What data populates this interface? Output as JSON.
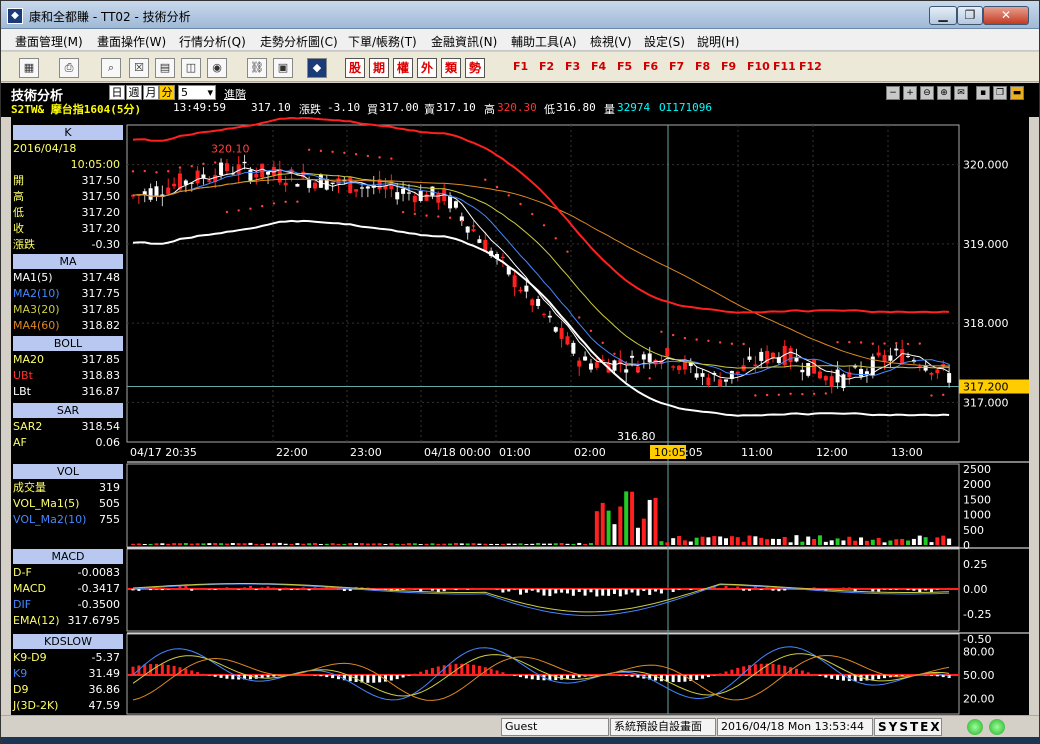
{
  "window": {
    "title": "康和全都賺 - TT02 - 技術分析"
  },
  "menu": [
    "畫面管理(M)",
    "畫面操作(W)",
    "行情分析(Q)",
    "走勢分析圖(C)",
    "下單/帳務(T)",
    "金融資訊(N)",
    "輔助工具(A)",
    "檢視(V)",
    "設定(S)",
    "說明(H)"
  ],
  "toolbar": {
    "red_buttons": [
      "股",
      "期",
      "權",
      "外",
      "類",
      "勢"
    ],
    "fkeys": [
      "F1",
      "F2",
      "F3",
      "F4",
      "F5",
      "F6",
      "F7",
      "F8",
      "F9",
      "F10",
      "F11",
      "F12"
    ]
  },
  "info": {
    "module": "技術分析",
    "periods": [
      "日",
      "週",
      "月",
      "分"
    ],
    "period_selected": "分",
    "interval": "5",
    "advanced": "進階",
    "symbol": "S2TW& 摩台指1604(5分)",
    "time": "13:49:59",
    "last": "317.10",
    "change_label": "漲跌",
    "change": "-3.10",
    "bid_label": "買",
    "bid": "317.00",
    "ask_label": "賣",
    "ask": "317.10",
    "high_label": "高",
    "high": "320.30",
    "low_label": "低",
    "low": "316.80",
    "vol_label": "量",
    "vol": "32974",
    "oi": "OI171096"
  },
  "left": {
    "k": {
      "header": "K",
      "date": "2016/04/18",
      "time": "10:05:00",
      "rows": [
        {
          "k": "開",
          "v": "317.50"
        },
        {
          "k": "高",
          "v": "317.50"
        },
        {
          "k": "低",
          "v": "317.20"
        },
        {
          "k": "收",
          "v": "317.20"
        },
        {
          "k": "漲跌",
          "v": "-0.30"
        }
      ]
    },
    "ma": {
      "header": "MA",
      "rows": [
        {
          "k": "MA1(5)",
          "v": "317.48"
        },
        {
          "k": "MA2(10)",
          "v": "317.75"
        },
        {
          "k": "MA3(20)",
          "v": "317.85"
        },
        {
          "k": "MA4(60)",
          "v": "318.82"
        }
      ]
    },
    "boll": {
      "header": "BOLL",
      "rows": [
        {
          "k": "MA20",
          "v": "317.85"
        },
        {
          "k": "UBt",
          "v": "318.83"
        },
        {
          "k": "LBt",
          "v": "316.87"
        }
      ]
    },
    "sar": {
      "header": "SAR",
      "rows": [
        {
          "k": "SAR2",
          "v": "318.54"
        },
        {
          "k": "AF",
          "v": "0.06"
        }
      ]
    },
    "vol": {
      "header": "VOL",
      "rows": [
        {
          "k": "成交量",
          "v": "319"
        },
        {
          "k": "VOL_Ma1(5)",
          "v": "505"
        },
        {
          "k": "VOL_Ma2(10)",
          "v": "755"
        }
      ]
    },
    "macd": {
      "header": "MACD",
      "rows": [
        {
          "k": "D-F",
          "v": "-0.0083"
        },
        {
          "k": "MACD",
          "v": "-0.3417"
        },
        {
          "k": "DIF",
          "v": "-0.3500"
        },
        {
          "k": "EMA(12)",
          "v": "317.6795"
        }
      ]
    },
    "kd": {
      "header": "KDSLOW",
      "rows": [
        {
          "k": "K9-D9",
          "v": "-5.37"
        },
        {
          "k": "K9",
          "v": "31.49"
        },
        {
          "k": "D9",
          "v": "36.86"
        },
        {
          "k": "J(3D-2K)",
          "v": "47.59"
        }
      ]
    }
  },
  "chart_data": {
    "type": "candlestick",
    "y_axis": [
      "320.000",
      "319.000",
      "318.000",
      "317.000"
    ],
    "ylim": [
      316.5,
      320.5
    ],
    "x_ticks": [
      "04/17 20:35",
      "22:00",
      "23:00",
      "04/18 00:00",
      "01:00",
      "02:00",
      "10:05",
      "11:00",
      "12:00",
      "13:00"
    ],
    "crosshair_time": "10:05",
    "crosshair_price": "317.200",
    "annotations": {
      "high": "320.10",
      "low": "316.80"
    },
    "vol_axis": [
      "2500",
      "2000",
      "1500",
      "1000",
      "500",
      "0"
    ],
    "macd_axis": [
      "0.25",
      "0.00",
      "-0.25",
      "-0.50"
    ],
    "kd_axis": [
      "80.00",
      "50.00",
      "20.00"
    ],
    "colors": {
      "up": "#ff2020",
      "down": "#ffffff",
      "ma1": "#ffffff",
      "ma2": "#4488ff",
      "ma3": "#cccc44",
      "ma4": "#dd8822",
      "upper_band": "#ff2020",
      "lower_band": "#ffffff",
      "sar": "#ff4040"
    }
  },
  "status": {
    "user": "Guest",
    "layout": "系統預設自設畫面",
    "datetime": "2016/04/18 Mon 13:53:44",
    "brand": "SYSTEX"
  }
}
